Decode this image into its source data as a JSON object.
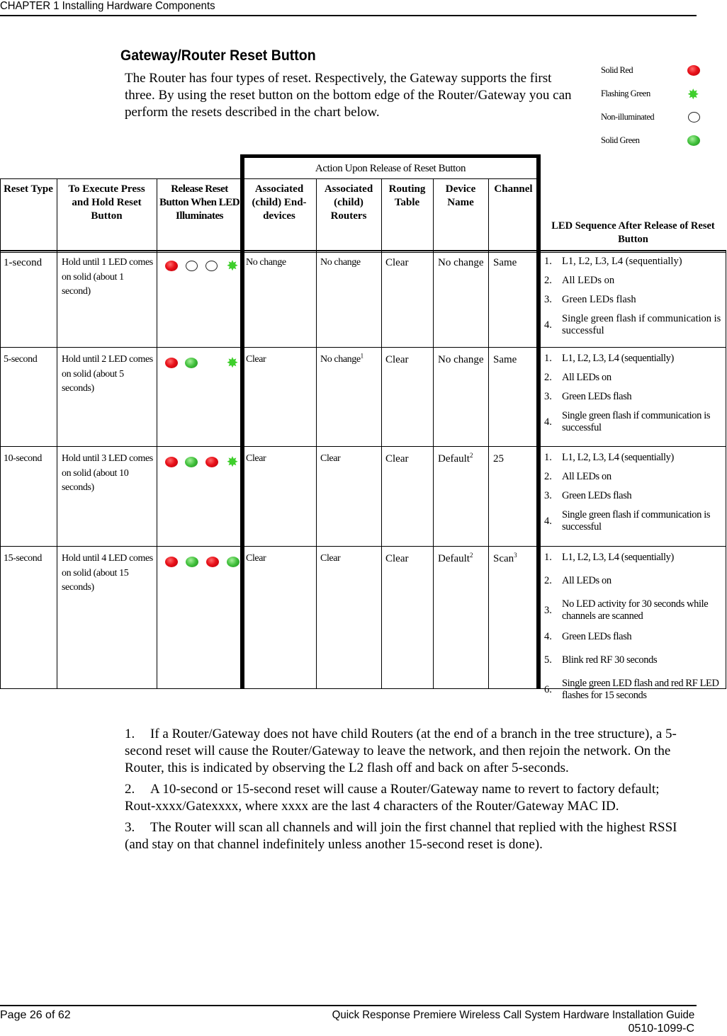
{
  "header": {
    "chapter": "CHAPTER 1 Installing Hardware Components"
  },
  "section": {
    "title": "Gateway/Router Reset Button",
    "intro": "The Router has four types of reset. Respectively, the Gateway supports the first three. By using the reset button on the bottom edge of the Router/Gateway you can perform the resets described in the chart below."
  },
  "legend": [
    {
      "label": "Solid Red",
      "icon": "solid-red-led"
    },
    {
      "label": "Flashing Green",
      "icon": "flashing-green-led"
    },
    {
      "label": "Non-illuminated",
      "icon": "non-illuminated-led"
    },
    {
      "label": "Solid Green",
      "icon": "solid-green-led"
    }
  ],
  "table": {
    "group_header": "Action Upon Release of Reset Button",
    "columns": {
      "reset_type": "Reset Type",
      "execute": "To Execute Press and Hold Reset Button",
      "release": "Release Reset Button When LED Illuminates",
      "end_devices": "Associated (child) End-devices",
      "routers": "Associated (child) Routers",
      "routing_table": "Routing Table",
      "device_name": "Device Name",
      "channel": "Channel",
      "led_sequence": "LED Sequence After Release of Reset Button"
    },
    "rows": [
      {
        "reset_type": "1-second",
        "execute": "Hold until 1 LED comes on solid (about 1 second)",
        "leds": [
          "red",
          "off",
          "off",
          "flash"
        ],
        "end_devices": "No change",
        "routers": "No change",
        "routers_sup": "",
        "routing_table": "Clear",
        "device_name": "No change",
        "device_name_sup": "",
        "channel": "Same",
        "channel_sup": "",
        "sequence": [
          "L1, L2, L3, L4 (sequentially)",
          "All LEDs on",
          "Green LEDs flash",
          "Single green flash if communication is successful"
        ]
      },
      {
        "reset_type": "5-second",
        "execute": "Hold until 2 LED comes on solid (about 5 seconds)",
        "leds": [
          "red",
          "green",
          "none",
          "flash"
        ],
        "end_devices": "Clear",
        "routers": "No change",
        "routers_sup": "1",
        "routing_table": "Clear",
        "device_name": "No change",
        "device_name_sup": "",
        "channel": "Same",
        "channel_sup": "",
        "sequence": [
          "L1, L2, L3, L4 (sequentially)",
          "All LEDs on",
          "Green LEDs flash",
          "Single green flash if communication is successful"
        ]
      },
      {
        "reset_type": "10-second",
        "execute": "Hold until 3 LED comes on solid (about 10 seconds)",
        "leds": [
          "red",
          "green",
          "red",
          "flash"
        ],
        "end_devices": "Clear",
        "routers": "Clear",
        "routers_sup": "",
        "routing_table": "Clear",
        "device_name": "Default",
        "device_name_sup": "2",
        "channel": "25",
        "channel_sup": "",
        "sequence": [
          "L1, L2, L3, L4 (sequentially)",
          "All LEDs on",
          "Green LEDs flash",
          "Single green flash if communication is successful"
        ]
      },
      {
        "reset_type": "15-second",
        "execute": "Hold until 4 LED comes on solid (about 15 seconds)",
        "leds": [
          "red",
          "green",
          "red",
          "green"
        ],
        "end_devices": "Clear",
        "routers": "Clear",
        "routers_sup": "",
        "routing_table": "Clear",
        "device_name": "Default",
        "device_name_sup": "2",
        "channel": "Scan",
        "channel_sup": "3",
        "sequence": [
          "L1, L2, L3, L4 (sequentially)",
          "All LEDs on",
          "No LED activity for 30 seconds while channels are scanned",
          "Green LEDs flash",
          "Blink red RF 30 seconds",
          "Single green LED flash and red RF LED flashes for 15 seconds"
        ]
      }
    ]
  },
  "footnotes": [
    {
      "num": "1.",
      "text": "If a Router/Gateway does not have child Routers (at the end of a branch in the tree structure), a 5-second reset will cause the Router/Gateway to leave the network, and then rejoin the network. On the Router, this is indicated by observing the L2 flash off and back on after 5-seconds."
    },
    {
      "num": "2.",
      "text": "A 10-second or 15-second reset will cause a Router/Gateway name to revert to factory default; Rout-xxxx/Gatexxxx, where xxxx are the last 4 characters of the Router/Gateway MAC ID."
    },
    {
      "num": "3.",
      "text": "The Router will scan all channels and will join the first channel that replied with the highest RSSI (and stay on that channel indefinitely unless another 15-second reset is done)."
    }
  ],
  "footer": {
    "page": "Page 26 of 62",
    "guide": "Quick Response Premiere Wireless Call System Hardware Installation Guide",
    "doc_id": "0510-1099-C"
  }
}
